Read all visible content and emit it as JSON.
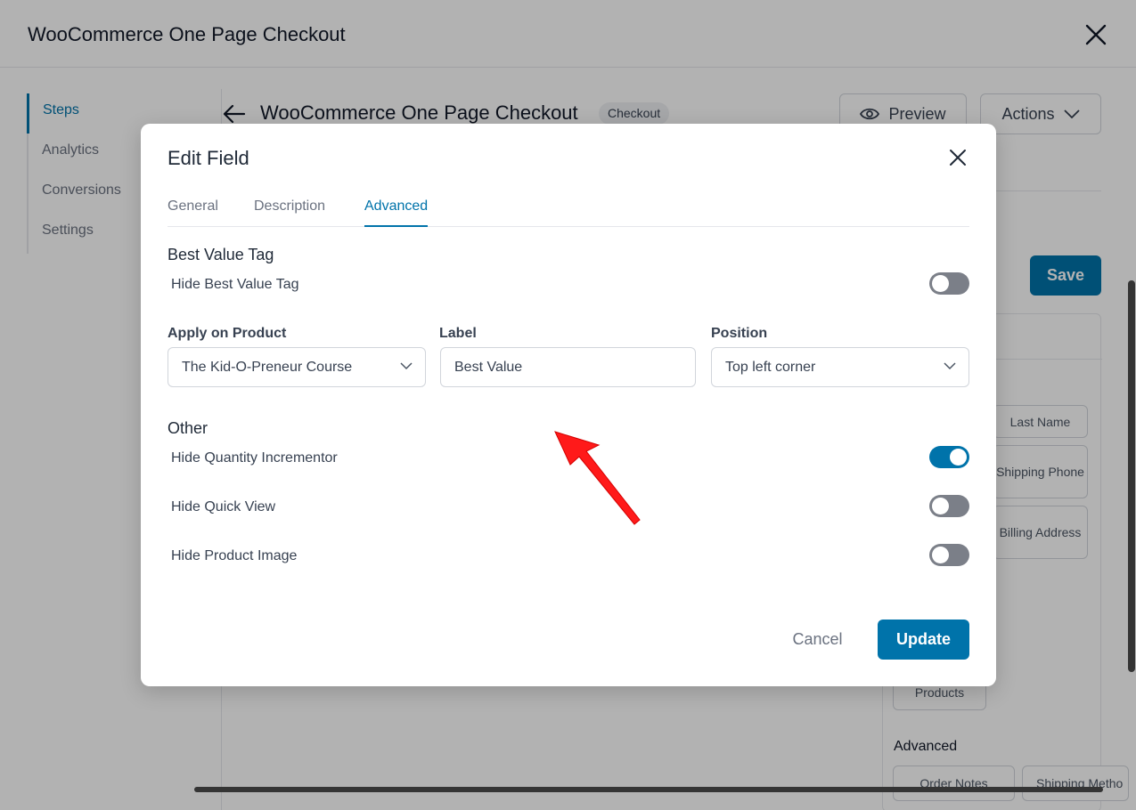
{
  "app": {
    "title": "WooCommerce One Page Checkout",
    "sidebar": [
      "Steps",
      "Analytics",
      "Conversions",
      "Settings"
    ],
    "funnel_title": "WooCommerce One Page Checkout",
    "badge": "Checkout",
    "preview_label": "Preview",
    "actions_label": "Actions",
    "save_label": "Save",
    "chips": [
      "Last Name",
      "Shipping Phone",
      "Billing Address",
      "Products",
      "Order Notes",
      "Shipping Metho"
    ],
    "advanced_label": "Advanced"
  },
  "modal": {
    "title": "Edit Field",
    "tabs": [
      "General",
      "Description",
      "Advanced"
    ],
    "active_tab": "Advanced",
    "best_value_section": "Best Value Tag",
    "hide_best_value": "Hide Best Value Tag",
    "hide_best_value_on": false,
    "fields": {
      "apply_label": "Apply on Product",
      "apply_value": "The Kid-O-Preneur Course",
      "label_label": "Label",
      "label_value": "Best Value",
      "position_label": "Position",
      "position_value": "Top left corner"
    },
    "other_section": "Other",
    "options": [
      {
        "label": "Hide Quantity Incrementor",
        "on": true
      },
      {
        "label": "Hide Quick View",
        "on": false
      },
      {
        "label": "Hide Product Image",
        "on": false
      }
    ],
    "cancel_label": "Cancel",
    "update_label": "Update"
  },
  "colors": {
    "accent": "#0073aa",
    "toggle_off": "#7b7f88",
    "annotation_arrow": "#ff1a1a"
  }
}
